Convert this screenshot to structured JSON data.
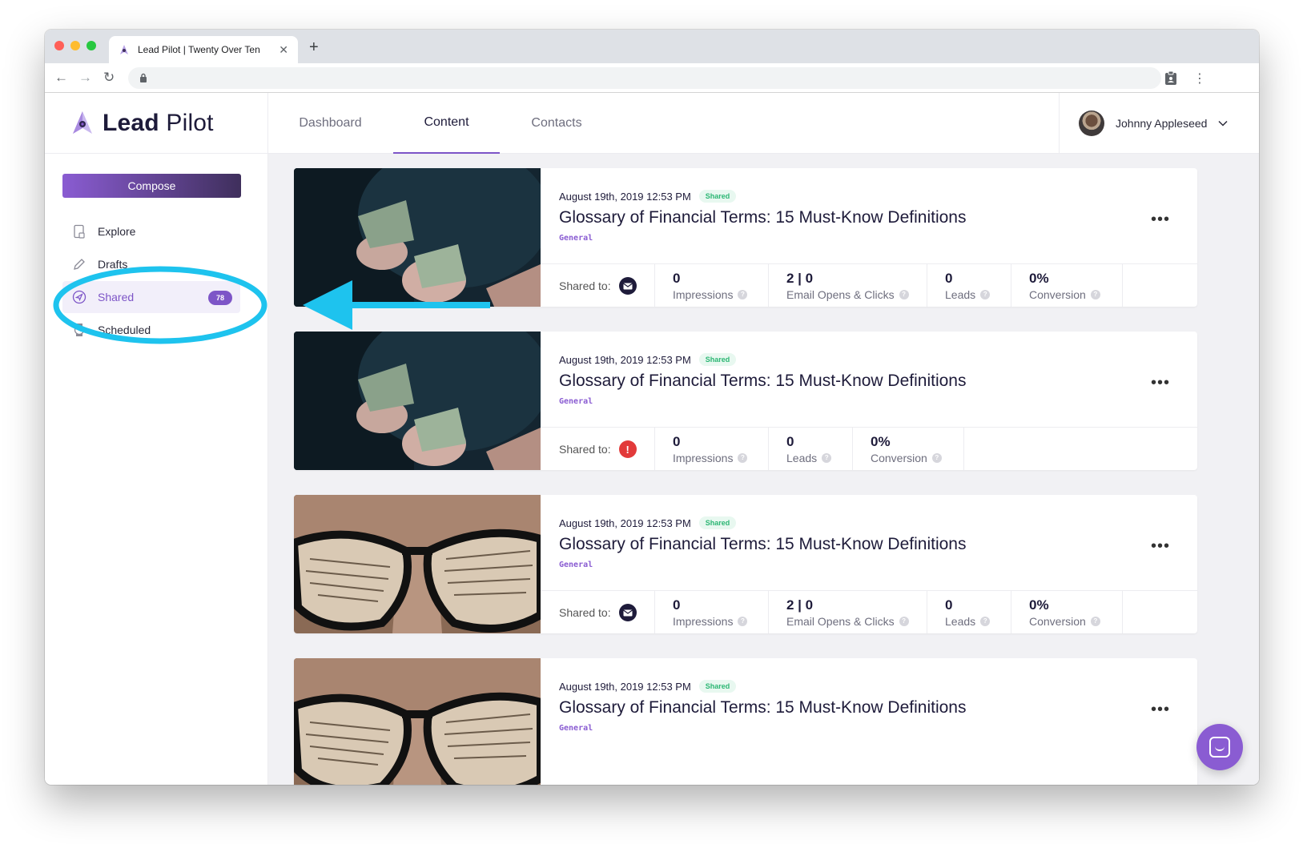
{
  "browser": {
    "tab_title": "Lead Pilot | Twenty Over Ten",
    "tab_close": "✕",
    "new_tab": "+",
    "back": "←",
    "forward": "→",
    "reload": "↻",
    "menu": "⋮"
  },
  "sidebar": {
    "logo_bold": "Lead",
    "logo_light": " Pilot",
    "compose_label": "Compose",
    "items": [
      {
        "label": "Explore",
        "icon": "tablet-icon"
      },
      {
        "label": "Drafts",
        "icon": "pencil-icon"
      },
      {
        "label": "Shared",
        "icon": "send-icon",
        "badge": "78"
      },
      {
        "label": "Scheduled",
        "icon": "clock-icon"
      }
    ]
  },
  "topnav": {
    "tabs": [
      {
        "label": "Dashboard"
      },
      {
        "label": "Content"
      },
      {
        "label": "Contacts"
      }
    ],
    "active_tab": "Content",
    "user_name": "Johnny Appleseed"
  },
  "cards": [
    {
      "date": "August 19th, 2019 12:53 PM",
      "status": "Shared",
      "title": "Glossary of Financial Terms: 15 Must-Know Definitions",
      "category": "General",
      "more": "•••",
      "shared_to_label": "Shared to:",
      "shared_icon": "mail-icon",
      "stats": [
        {
          "value": "0",
          "label": "Impressions"
        },
        {
          "value": "2 | 0",
          "label": "Email Opens & Clicks"
        },
        {
          "value": "0",
          "label": "Leads"
        },
        {
          "value": "0%",
          "label": "Conversion"
        }
      ]
    },
    {
      "date": "August 19th, 2019 12:53 PM",
      "status": "Shared",
      "title": "Glossary of Financial Terms: 15 Must-Know Definitions",
      "category": "General",
      "more": "•••",
      "shared_to_label": "Shared to:",
      "shared_icon": "error-icon",
      "stats": [
        {
          "value": "0",
          "label": "Impressions"
        },
        {
          "value": "0",
          "label": "Leads"
        },
        {
          "value": "0%",
          "label": "Conversion"
        }
      ]
    },
    {
      "date": "August 19th, 2019 12:53 PM",
      "status": "Shared",
      "title": "Glossary of Financial Terms: 15 Must-Know Definitions",
      "category": "General",
      "more": "•••",
      "shared_to_label": "Shared to:",
      "shared_icon": "mail-icon",
      "stats": [
        {
          "value": "0",
          "label": "Impressions"
        },
        {
          "value": "2 | 0",
          "label": "Email Opens & Clicks"
        },
        {
          "value": "0",
          "label": "Leads"
        },
        {
          "value": "0%",
          "label": "Conversion"
        }
      ]
    },
    {
      "date": "August 19th, 2019 12:53 PM",
      "status": "Shared",
      "title": "Glossary of Financial Terms: 15 Must-Know Definitions",
      "category": "General",
      "more": "•••"
    }
  ],
  "colors": {
    "accent": "#7d55c7",
    "annotation": "#1ec3ee",
    "shared_green": "#2bb673",
    "error_red": "#e23a3a"
  }
}
